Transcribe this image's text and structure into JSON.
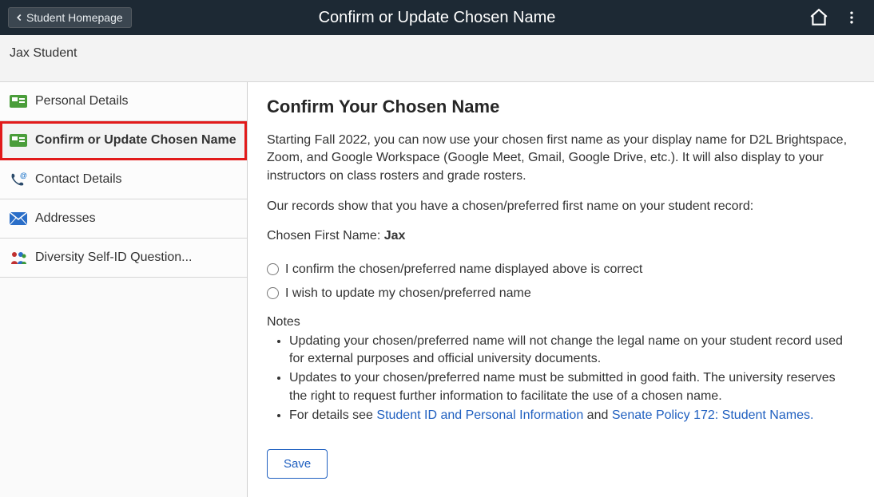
{
  "header": {
    "back_label": "Student Homepage",
    "title": "Confirm or Update Chosen Name"
  },
  "subheader": {
    "name": "Jax Student"
  },
  "sidebar": {
    "items": [
      {
        "label": "Personal Details"
      },
      {
        "label": "Confirm or Update Chosen Name"
      },
      {
        "label": "Contact Details"
      },
      {
        "label": "Addresses"
      },
      {
        "label": "Diversity Self-ID Question..."
      }
    ]
  },
  "main": {
    "heading": "Confirm Your Chosen Name",
    "intro": "Starting Fall 2022, you can now use your chosen first name as your display name for D2L Brightspace, Zoom, and Google Workspace (Google Meet, Gmail, Google Drive, etc.). It will also display to your instructors on class rosters and grade rosters.",
    "records_line": "Our records show that you have a chosen/preferred first name on your student record:",
    "chosen_label": "Chosen First Name: ",
    "chosen_value": "Jax",
    "radio1": "I confirm the chosen/preferred name displayed above is correct",
    "radio2": "I wish to update my chosen/preferred name",
    "notes_heading": "Notes",
    "notes": [
      "Updating your chosen/preferred name will not change the legal name on your student record used for external purposes and official university documents.",
      "Updates to your chosen/preferred name must be submitted in good faith. The university reserves the right to request further information to facilitate the use of a chosen name."
    ],
    "note3_prefix": "For details see ",
    "note3_link1": "Student ID and Personal Information",
    "note3_mid": " and ",
    "note3_link2": "Senate Policy 172: Student Names.",
    "save_label": "Save"
  }
}
